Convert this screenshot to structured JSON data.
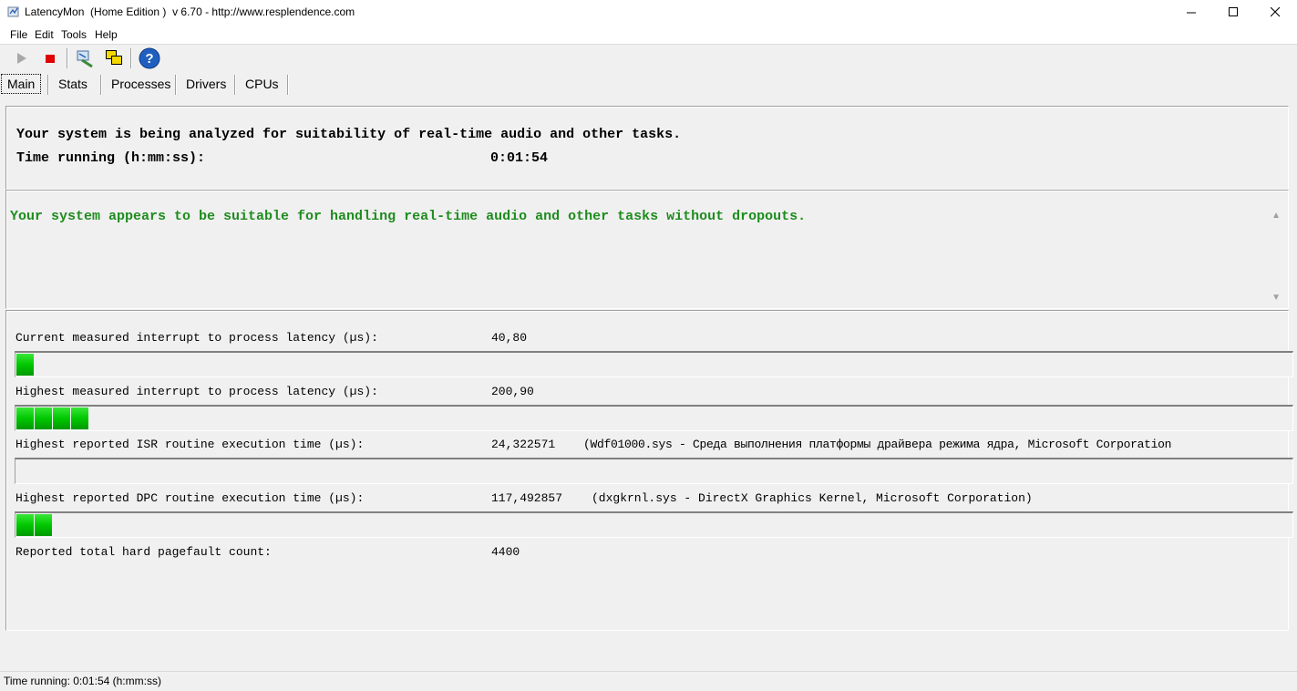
{
  "window": {
    "title": "LatencyMon  (Home Edition )  v 6.70 - http://www.resplendence.com",
    "icon": "latencymon-app-icon"
  },
  "menu": [
    {
      "label": "File"
    },
    {
      "label": "Edit"
    },
    {
      "label": "Tools"
    },
    {
      "label": "Help"
    }
  ],
  "toolbar": {
    "buttons": [
      "play-icon",
      "stop-icon",
      "cleanup-icon",
      "windows-icon",
      "help-icon"
    ]
  },
  "tabs": [
    {
      "label": "Main",
      "active": true
    },
    {
      "label": "Stats"
    },
    {
      "label": "Processes"
    },
    {
      "label": "Drivers"
    },
    {
      "label": "CPUs"
    }
  ],
  "summary": {
    "line1": "Your system is being analyzed for suitability of real-time audio and other tasks.",
    "time_label": "Time running (h:mm:ss):",
    "time_value": "0:01:54"
  },
  "verdict": {
    "text": "Your system appears to be suitable for handling real-time audio and other tasks without dropouts.",
    "color": "#1e8c1e"
  },
  "metrics": [
    {
      "label": "Current measured interrupt to process latency (µs):",
      "value": "40,80",
      "detail": "",
      "bar_fraction": 0.014
    },
    {
      "label": "Highest measured interrupt to process latency (µs):",
      "value": "200,90",
      "detail": "",
      "bar_fraction": 0.057
    },
    {
      "label": "Highest reported ISR routine execution time (µs):",
      "value": "24,322571",
      "detail": "(Wdf01000.sys - Среда выполнения платформы драйвера режима ядра, Microsoft Corporation",
      "bar_fraction": 0.0
    },
    {
      "label": "Highest reported DPC routine execution time (µs):",
      "value": "117,492857",
      "detail": "(dxgkrnl.sys - DirectX Graphics Kernel, Microsoft Corporation)",
      "bar_fraction": 0.028
    },
    {
      "label": "Reported total hard pagefault count:",
      "value": "4400",
      "detail": ""
    }
  ],
  "colors": {
    "bar_green": "#00c800",
    "accent": "#1e8c1e"
  },
  "status": {
    "text": "Time running: 0:01:54  (h:mm:ss)"
  }
}
